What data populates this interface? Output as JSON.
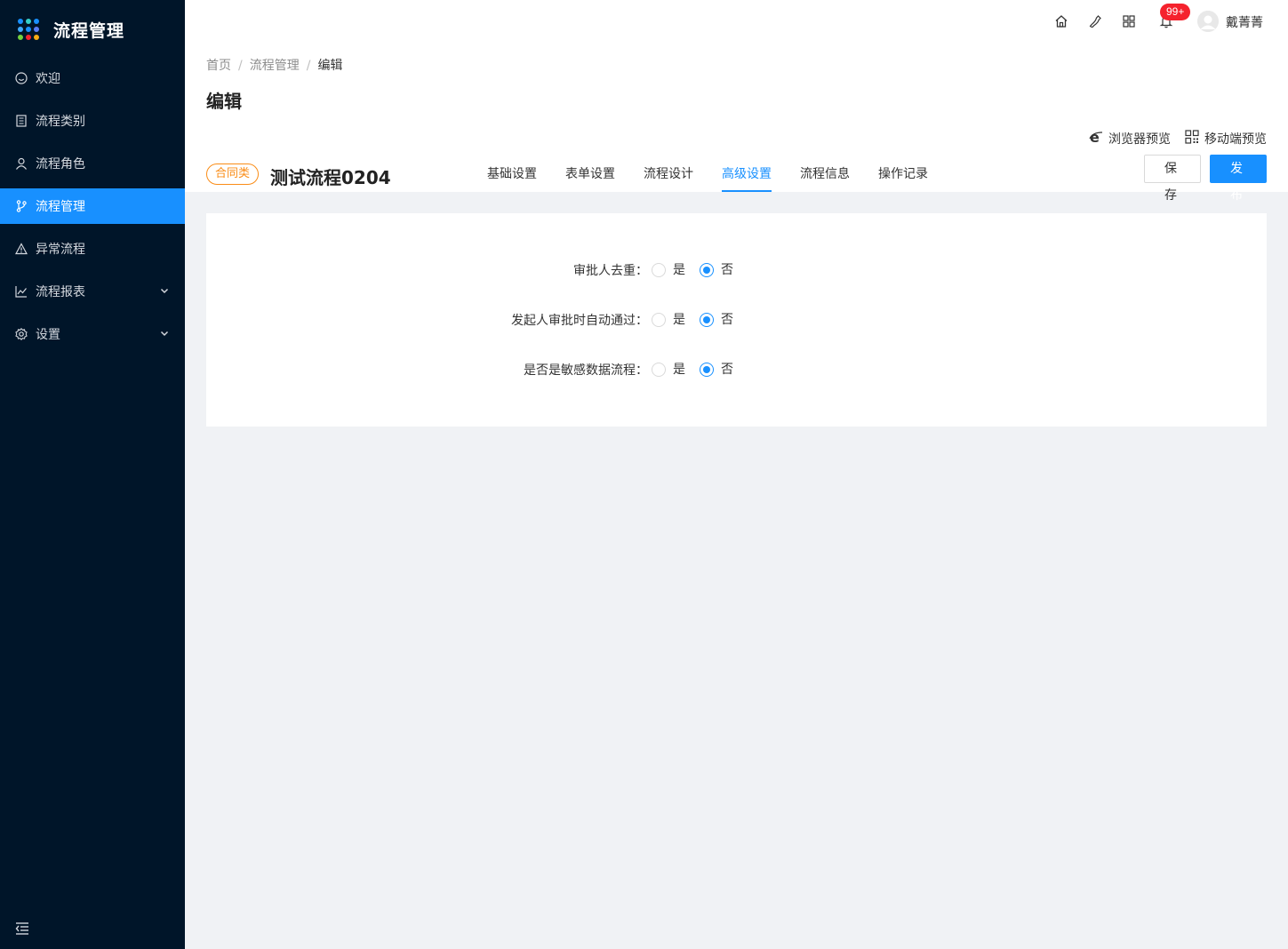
{
  "app": {
    "title": "流程管理"
  },
  "sidebar": {
    "items": [
      {
        "label": "欢迎",
        "icon": "smile-icon",
        "active": false
      },
      {
        "label": "流程类别",
        "icon": "list-icon",
        "active": false
      },
      {
        "label": "流程角色",
        "icon": "user-icon",
        "active": false
      },
      {
        "label": "流程管理",
        "icon": "branch-icon",
        "active": true
      },
      {
        "label": "异常流程",
        "icon": "warning-icon",
        "active": false
      },
      {
        "label": "流程报表",
        "icon": "line-chart-icon",
        "active": false,
        "expandable": true
      },
      {
        "label": "设置",
        "icon": "gear-icon",
        "active": false,
        "expandable": true
      }
    ]
  },
  "header": {
    "notification_count": "99+",
    "username": "戴菁菁"
  },
  "breadcrumb": {
    "items": [
      "首页",
      "流程管理",
      "编辑"
    ]
  },
  "page": {
    "title": "编辑",
    "preview_browser": "浏览器预览",
    "preview_mobile": "移动端预览",
    "tag": "合同类",
    "process_name": "测试流程0204",
    "tabs": [
      "基础设置",
      "表单设置",
      "流程设计",
      "高级设置",
      "流程信息",
      "操作记录"
    ],
    "active_tab": "高级设置",
    "save_label": "保存",
    "publish_label": "发布"
  },
  "settings": {
    "rows": [
      {
        "label": "审批人去重：",
        "yes": "是",
        "no": "否",
        "selected": "否"
      },
      {
        "label": "发起人审批时自动通过：",
        "yes": "是",
        "no": "否",
        "selected": "否"
      },
      {
        "label": "是否是敏感数据流程：",
        "yes": "是",
        "no": "否",
        "selected": "否"
      }
    ]
  },
  "colors": {
    "sidebar_bg": "#001529",
    "primary": "#1890ff",
    "tag": "#fa8c16",
    "badge": "#f5222d"
  }
}
